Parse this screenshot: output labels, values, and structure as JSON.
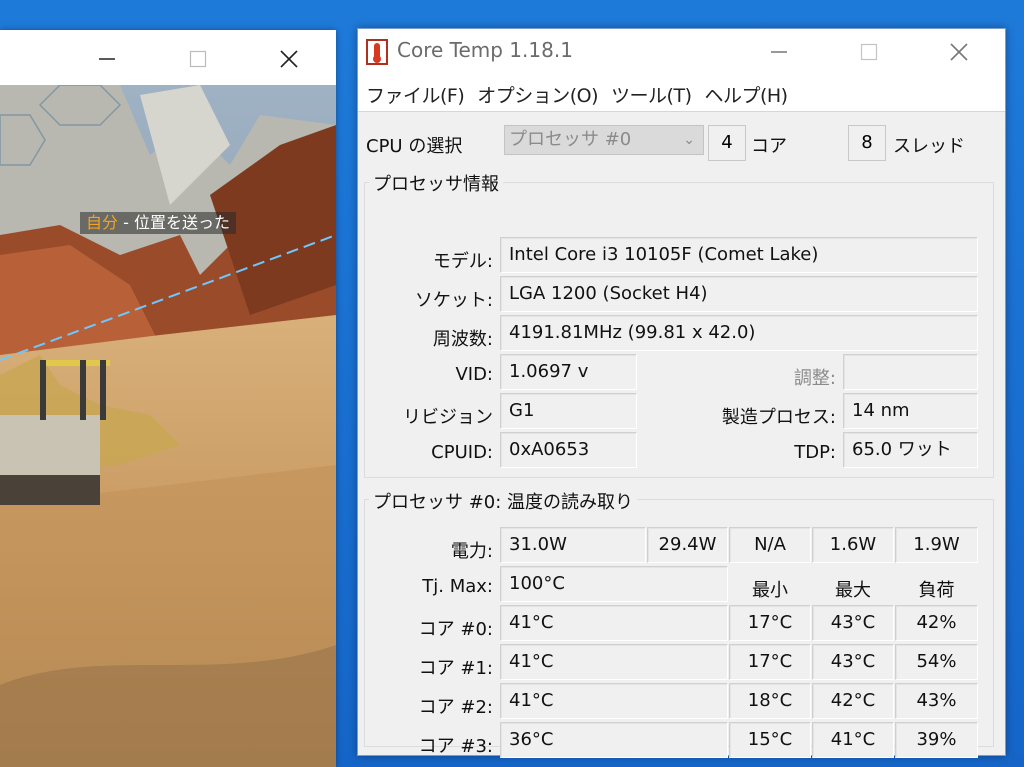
{
  "game_window": {
    "minimize": "—",
    "maximize": "☐",
    "close": "✕",
    "ping_me": "自分",
    "ping_text": " - 位置を送った"
  },
  "app": {
    "title": "Core Temp 1.18.1",
    "minimize": "—",
    "maximize": "☐",
    "close": "✕"
  },
  "menu": [
    "ファイル(F)",
    "オプション(O)",
    "ツール(T)",
    "ヘルプ(H)"
  ],
  "cpu_select": {
    "label": "CPU の選択",
    "selected": "プロセッサ #0",
    "cores_value": "4",
    "cores_label": "コア",
    "threads_value": "8",
    "threads_label": "スレッド"
  },
  "processor_info": {
    "title": "プロセッサ情報",
    "model_label": "モデル:",
    "model": "Intel Core i3 10105F (Comet Lake)",
    "socket_label": "ソケット:",
    "socket": "LGA 1200 (Socket H4)",
    "freq_label": "周波数:",
    "freq": "4191.81MHz (99.81 x 42.0)",
    "vid_label": "VID:",
    "vid": "1.0697 v",
    "adjust_label": "調整:",
    "adjust": "",
    "revision_label": "リビジョン",
    "revision": "G1",
    "process_label": "製造プロセス:",
    "process": "14 nm",
    "cpuid_label": "CPUID:",
    "cpuid": "0xA0653",
    "tdp_label": "TDP:",
    "tdp": "65.0 ワット"
  },
  "temps": {
    "title": "プロセッサ #0: 温度の読み取り",
    "power_label": "電力:",
    "power": [
      "31.0W",
      "29.4W",
      "N/A",
      "1.6W",
      "1.9W"
    ],
    "tjmax_label": "Tj. Max:",
    "tjmax": "100°C",
    "col_min": "最小",
    "col_max": "最大",
    "col_load": "負荷",
    "cores": [
      {
        "label": "コア #0:",
        "temp": "41°C",
        "min": "17°C",
        "max": "43°C",
        "load": "42%"
      },
      {
        "label": "コア #1:",
        "temp": "41°C",
        "min": "17°C",
        "max": "43°C",
        "load": "54%"
      },
      {
        "label": "コア #2:",
        "temp": "41°C",
        "min": "18°C",
        "max": "42°C",
        "load": "43%"
      },
      {
        "label": "コア #3:",
        "temp": "36°C",
        "min": "15°C",
        "max": "41°C",
        "load": "39%"
      }
    ]
  }
}
